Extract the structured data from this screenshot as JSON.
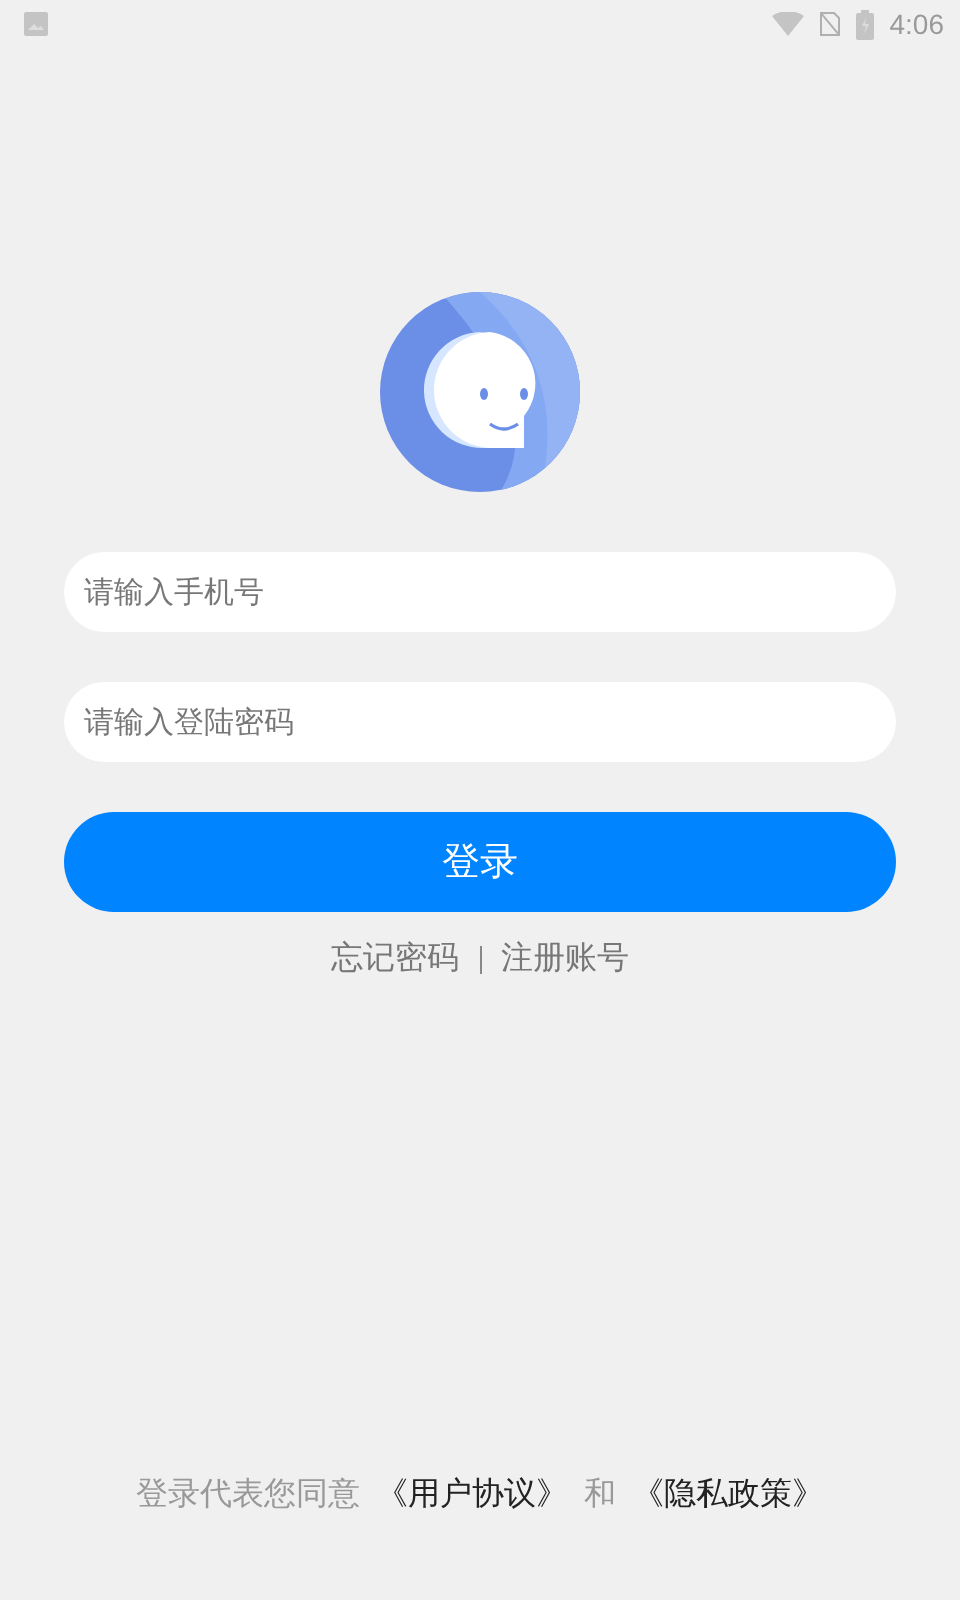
{
  "status_bar": {
    "time": "4:06"
  },
  "phone_field": {
    "placeholder": "请输入手机号"
  },
  "password_field": {
    "placeholder": "请输入登陆密码"
  },
  "login_button": {
    "label": "登录"
  },
  "links": [
    "忘记密码",
    "注册账号"
  ],
  "agreement": {
    "prefix": "登录代表您同意",
    "user_agreement": "《用户协议》",
    "conjunction": "和",
    "privacy_policy": "《隐私政策》"
  }
}
